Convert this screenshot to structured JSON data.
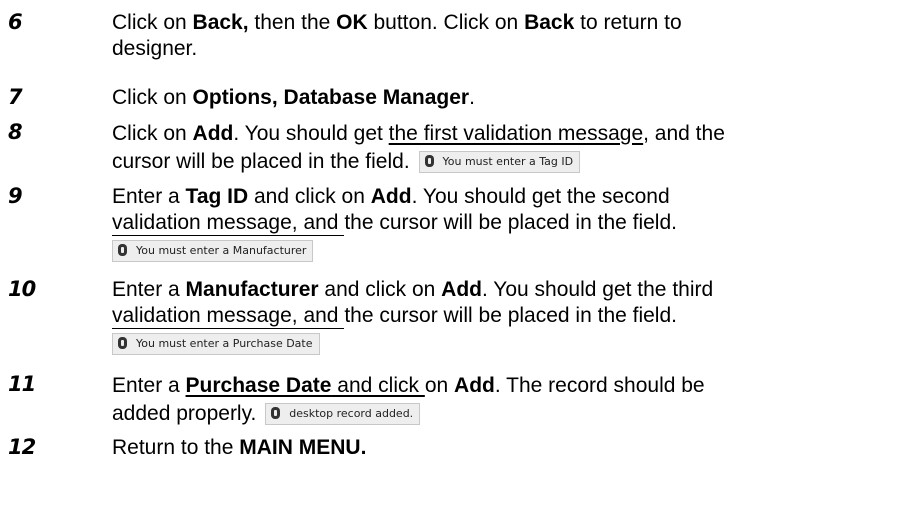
{
  "steps": [
    {
      "num": "6",
      "parts": [
        "Click on ",
        "Back,",
        " then the ",
        "OK",
        " button.  Click on ",
        "Back",
        " to return to"
      ],
      "line2": "designer."
    },
    {
      "num": "7",
      "parts": [
        "Click on ",
        "Options, Database Manager",
        "."
      ]
    },
    {
      "num": "8",
      "parts": [
        "Click on ",
        "Add",
        ".  You should get ",
        "the first validation message",
        ", and the"
      ],
      "line2": "cursor will be placed in the field.",
      "message": "You must enter a Tag ID"
    },
    {
      "num": "9",
      "parts": [
        "Enter a ",
        "Tag ID",
        " and click on ",
        "Add",
        ".  You should get the second"
      ],
      "line2a": "validation message, and ",
      "line2b": "the cursor will be placed in the field.",
      "message": "You must enter a Manufacturer"
    },
    {
      "num": "10",
      "parts": [
        "Enter a ",
        "Manufacturer",
        " and click on ",
        "Add",
        ".  You should get the third"
      ],
      "line2a": "validation message, and ",
      "line2b": "the cursor will be placed in the field.",
      "message": "You must enter a Purchase Date"
    },
    {
      "num": "11",
      "parts": [
        "Enter a ",
        "Purchase Date",
        " and click ",
        "on ",
        "Add",
        ".  The record should be"
      ],
      "line2": "added properly.",
      "message": "desktop record added."
    },
    {
      "num": "12",
      "parts": [
        "Return to the ",
        "MAIN MENU."
      ]
    }
  ]
}
